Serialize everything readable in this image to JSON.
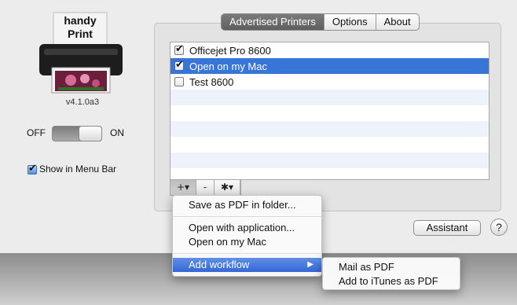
{
  "app": {
    "icon_label_top": "handy",
    "icon_label_bottom": "Print",
    "version": "v4.1.0a3"
  },
  "power": {
    "off_label": "OFF",
    "on_label": "ON",
    "state": "on"
  },
  "show_in_menu_bar": {
    "label": "Show in Menu Bar",
    "checked": true
  },
  "tabs": [
    {
      "label": "Advertised Printers",
      "active": true
    },
    {
      "label": "Options",
      "active": false
    },
    {
      "label": "About",
      "active": false
    }
  ],
  "printers": [
    {
      "name": "Officejet Pro 8600",
      "checked": true,
      "selected": false
    },
    {
      "name": "Open on my Mac",
      "checked": true,
      "selected": true
    },
    {
      "name": "Test 8600",
      "checked": false,
      "selected": false
    }
  ],
  "list_buttons": {
    "add": "+▾",
    "remove": "-",
    "action": "✱▾"
  },
  "assistant_button": "Assistant",
  "help_button": "?",
  "add_menu": {
    "items": [
      {
        "label": "Save as PDF in folder..."
      },
      {
        "separator": true
      },
      {
        "label": "Open with application..."
      },
      {
        "label": "Open on my Mac"
      },
      {
        "separator": true
      },
      {
        "label": "Add workflow",
        "highlighted": true,
        "submenu": true
      }
    ]
  },
  "workflow_submenu": {
    "items": [
      {
        "label": "Mail as PDF"
      },
      {
        "label": "Add to iTunes as PDF"
      }
    ]
  },
  "colors": {
    "selection": "#3875d7",
    "menu_highlight": "#3467d6"
  }
}
